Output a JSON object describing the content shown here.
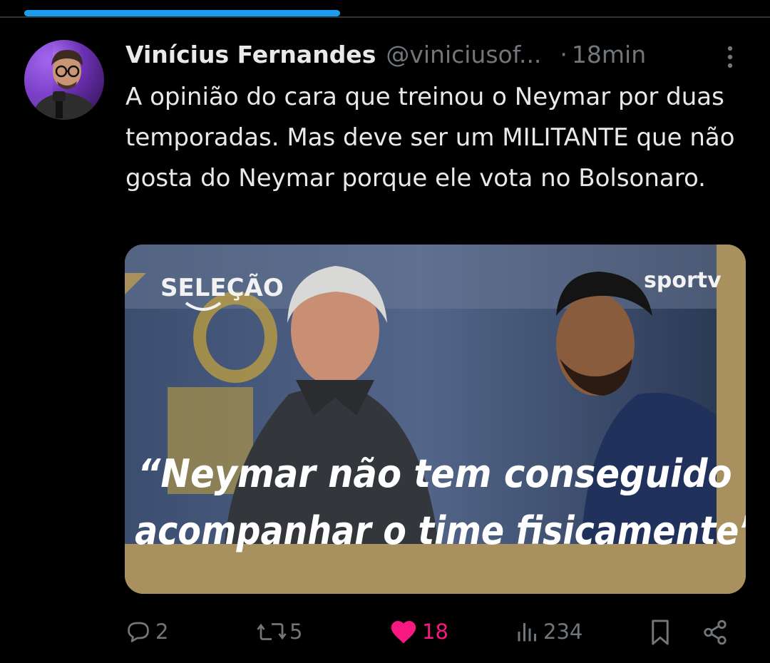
{
  "top_bar": {
    "progress": 0.41
  },
  "tweet": {
    "author": {
      "name": "Vinícius Fernandes",
      "handle": "@viniciusof...",
      "avatar_icon": "avatar-photo"
    },
    "separator": "·",
    "time": "18min",
    "text": "A opinião do cara que treinou o Neymar por duas temporadas. Mas deve ser um MILITANTE que não gosta do Neymar porque ele vota no Bolsonaro.",
    "media": {
      "brand_left": "SELEÇÃO",
      "brand_right": "sportv",
      "quote_line1": "“Neymar não tem conseguido",
      "quote_line2": "acompanhar o time fisicamente”"
    }
  },
  "actions": {
    "replies": "2",
    "reposts": "5",
    "likes": "18",
    "views": "234",
    "icons": [
      "reply-icon",
      "repost-icon",
      "like-icon",
      "views-icon",
      "bookmark-icon",
      "share-icon"
    ]
  },
  "colors": {
    "background": "#000000",
    "text": "#e7e9ea",
    "muted": "#71767b",
    "like": "#f91880",
    "progress": "#1d9bf0",
    "media_frame": "#a9905f"
  }
}
